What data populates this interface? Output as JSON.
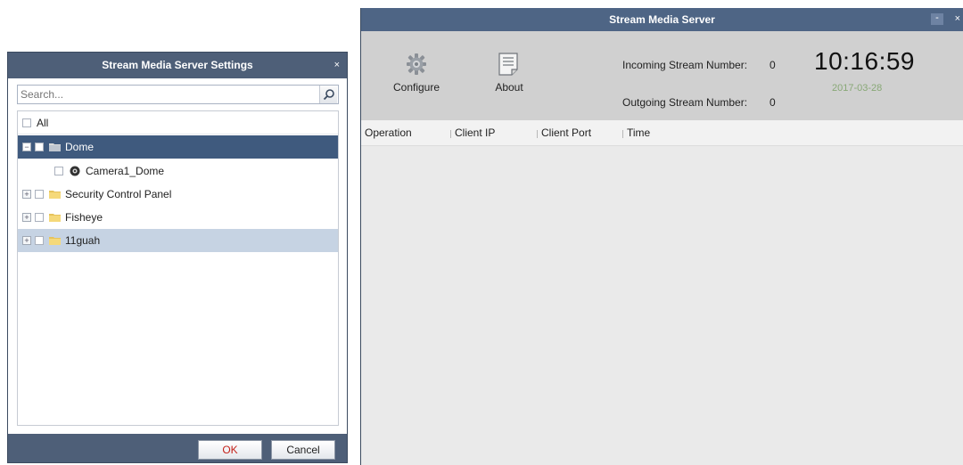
{
  "dialog": {
    "title": "Stream Media Server Settings",
    "close_glyph": "×",
    "search": {
      "placeholder": "Search..."
    },
    "tree": {
      "all_label": "All",
      "items": [
        {
          "label": "Dome",
          "state": "selected",
          "expanded": true
        },
        {
          "label": "Camera1_Dome",
          "type": "camera"
        },
        {
          "label": "Security Control Panel",
          "expanded": false
        },
        {
          "label": "Fisheye",
          "expanded": false
        },
        {
          "label": "11guah",
          "state": "hover",
          "expanded": false
        }
      ]
    },
    "buttons": {
      "ok": "OK",
      "cancel": "Cancel"
    }
  },
  "window": {
    "title": "Stream Media Server",
    "minimize_glyph": "-",
    "close_glyph": "×",
    "toolbar": {
      "configure_label": "Configure",
      "about_label": "About",
      "incoming_label": "Incoming Stream Number:",
      "incoming_value": "0",
      "outgoing_label": "Outgoing Stream Number:",
      "outgoing_value": "0",
      "time": "10:16:59",
      "date": "2017-03-28"
    },
    "table": {
      "columns": [
        "Operation",
        "Client IP",
        "Client Port",
        "Time"
      ],
      "rows": []
    }
  },
  "colors": {
    "title_bar": "#4e6585",
    "dialog_frame": "#4e5f78",
    "selected_row": "#3f5a7e",
    "hover_row": "#c6d3e3",
    "ok_text": "#c4221a",
    "date_text": "#88a876"
  },
  "icons": [
    "close-icon",
    "search-icon",
    "folder-icon",
    "camera-icon",
    "gear-icon",
    "document-icon",
    "minimize-icon",
    "expand-icon",
    "collapse-icon"
  ]
}
